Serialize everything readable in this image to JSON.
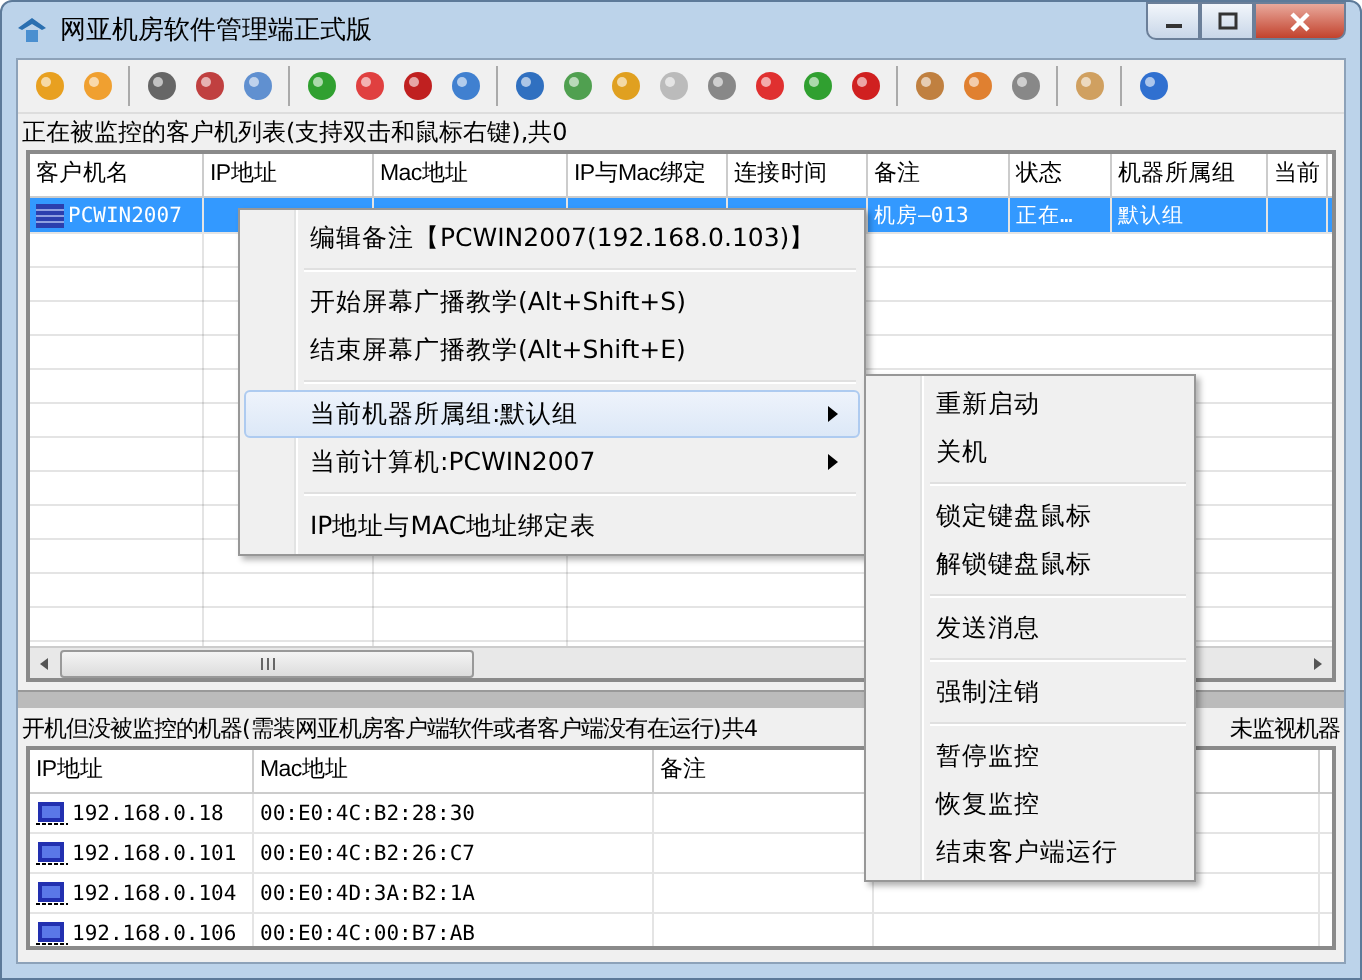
{
  "window": {
    "title": "网亚机房软件管理端正式版"
  },
  "monitored": {
    "label": "正在被监控的客户机列表(支持双击和鼠标右键),共0",
    "columns": [
      "客户机名",
      "IP地址",
      "Mac地址",
      "IP与Mac绑定",
      "连接时间",
      "备注",
      "状态",
      "机器所属组",
      "当前"
    ],
    "rows": [
      {
        "selected": true,
        "name": "PCWIN2007",
        "note": "机房—013",
        "status": "正在…",
        "group": "默认组"
      }
    ]
  },
  "unmonitored": {
    "label": "开机但没被监控的机器(需装网亚机房客户端软件或者客户端没有在运行)共4",
    "side_label": "未监视机器",
    "columns": [
      "IP地址",
      "Mac地址",
      "备注"
    ],
    "rows": [
      {
        "ip": "192.168.0.18",
        "mac": "00:E0:4C:B2:28:30"
      },
      {
        "ip": "192.168.0.101",
        "mac": "00:E0:4C:B2:26:C7"
      },
      {
        "ip": "192.168.0.104",
        "mac": "00:E0:4D:3A:B2:1A"
      },
      {
        "ip": "192.168.0.106",
        "mac": "00:E0:4C:00:B7:AB"
      }
    ]
  },
  "context_menu": {
    "groups": [
      [
        {
          "label": "编辑备注【PCWIN2007(192.168.0.103)】",
          "selected": false,
          "has_submenu": false
        }
      ],
      [
        {
          "label": "开始屏幕广播教学(Alt+Shift+S)",
          "selected": false,
          "has_submenu": false
        },
        {
          "label": "结束屏幕广播教学(Alt+Shift+E)",
          "selected": false,
          "has_submenu": false
        }
      ],
      [
        {
          "label": "当前机器所属组:默认组",
          "selected": true,
          "has_submenu": true
        },
        {
          "label": "当前计算机:PCWIN2007",
          "selected": false,
          "has_submenu": true
        }
      ],
      [
        {
          "label": "IP地址与MAC地址绑定表",
          "selected": false,
          "has_submenu": false
        }
      ]
    ]
  },
  "submenu": {
    "groups": [
      [
        {
          "label": "重新启动",
          "selected": false
        },
        {
          "label": "关机",
          "selected": false
        }
      ],
      [
        {
          "label": "锁定键盘鼠标",
          "selected": false
        },
        {
          "label": "解锁键盘鼠标",
          "selected": false
        }
      ],
      [
        {
          "label": "发送消息",
          "selected": false
        }
      ],
      [
        {
          "label": "强制注销",
          "selected": false
        }
      ],
      [
        {
          "label": "暂停监控",
          "selected": false
        },
        {
          "label": "恢复监控",
          "selected": false
        },
        {
          "label": "结束客户端运行",
          "selected": false
        }
      ]
    ]
  }
}
